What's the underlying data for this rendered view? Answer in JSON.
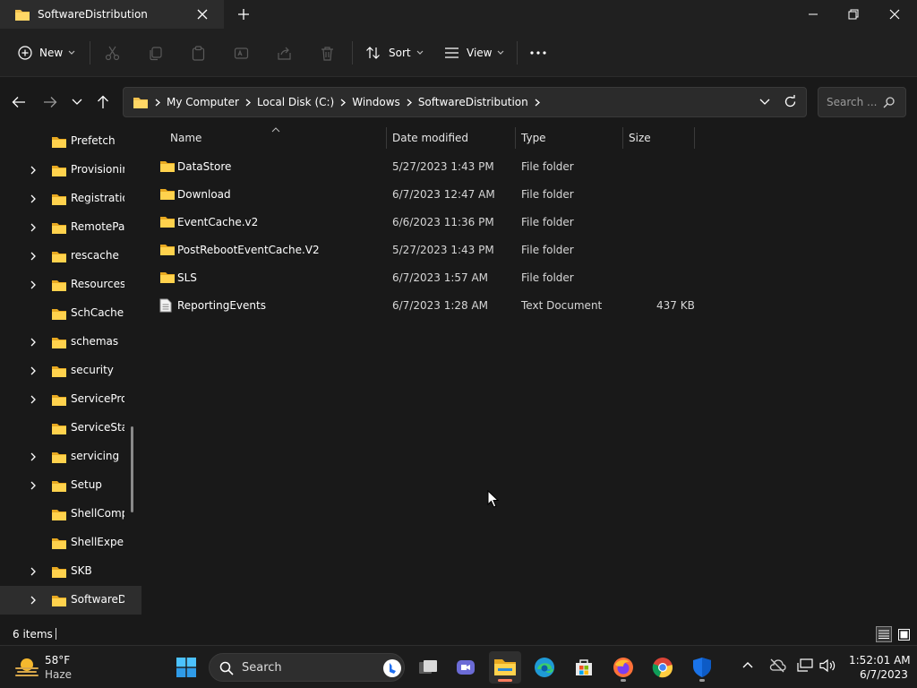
{
  "window": {
    "tab_title": "SoftwareDistribution",
    "buttons": [
      "minimize",
      "maximize",
      "close"
    ]
  },
  "toolbar": {
    "new_label": "New",
    "sort_label": "Sort",
    "view_label": "View",
    "icons": [
      "cut-icon",
      "copy-icon",
      "paste-icon",
      "rename-icon",
      "share-icon",
      "delete-icon",
      "more-icon"
    ]
  },
  "address": {
    "breadcrumbs": [
      "My Computer",
      "Local Disk (C:)",
      "Windows",
      "SoftwareDistribution"
    ],
    "search_placeholder": "Search ..."
  },
  "sidebar": {
    "items": [
      {
        "label": "Prefetch",
        "expandable": false,
        "selected": false
      },
      {
        "label": "Provisioning",
        "expandable": true,
        "selected": false
      },
      {
        "label": "Registration",
        "expandable": true,
        "selected": false
      },
      {
        "label": "RemotePackages",
        "expandable": true,
        "selected": false
      },
      {
        "label": "rescache",
        "expandable": true,
        "selected": false
      },
      {
        "label": "Resources",
        "expandable": true,
        "selected": false
      },
      {
        "label": "SchCache",
        "expandable": false,
        "selected": false
      },
      {
        "label": "schemas",
        "expandable": true,
        "selected": false
      },
      {
        "label": "security",
        "expandable": true,
        "selected": false
      },
      {
        "label": "ServiceProfiles",
        "expandable": true,
        "selected": false
      },
      {
        "label": "ServiceState",
        "expandable": false,
        "selected": false
      },
      {
        "label": "servicing",
        "expandable": true,
        "selected": false
      },
      {
        "label": "Setup",
        "expandable": true,
        "selected": false
      },
      {
        "label": "ShellComponents",
        "expandable": false,
        "selected": false
      },
      {
        "label": "ShellExperiences",
        "expandable": false,
        "selected": false
      },
      {
        "label": "SKB",
        "expandable": true,
        "selected": false
      },
      {
        "label": "SoftwareDistribution",
        "expandable": true,
        "selected": true
      }
    ]
  },
  "columns": {
    "name": "Name",
    "date": "Date modified",
    "type": "Type",
    "size": "Size"
  },
  "files": [
    {
      "name": "DataStore",
      "date": "5/27/2023 1:43 PM",
      "type": "File folder",
      "size": "",
      "kind": "folder"
    },
    {
      "name": "Download",
      "date": "6/7/2023 12:47 AM",
      "type": "File folder",
      "size": "",
      "kind": "folder"
    },
    {
      "name": "EventCache.v2",
      "date": "6/6/2023 11:36 PM",
      "type": "File folder",
      "size": "",
      "kind": "folder"
    },
    {
      "name": "PostRebootEventCache.V2",
      "date": "5/27/2023 1:43 PM",
      "type": "File folder",
      "size": "",
      "kind": "folder"
    },
    {
      "name": "SLS",
      "date": "6/7/2023 1:57 AM",
      "type": "File folder",
      "size": "",
      "kind": "folder"
    },
    {
      "name": "ReportingEvents",
      "date": "6/7/2023 1:28 AM",
      "type": "Text Document",
      "size": "437 KB",
      "kind": "text"
    }
  ],
  "status": {
    "item_count": "6 items"
  },
  "taskbar": {
    "weather_temp": "58°F",
    "weather_condition": "Haze",
    "search_label": "Search",
    "apps": [
      "start",
      "task-view",
      "teams-meet",
      "file-explorer",
      "edge",
      "microsoft-store",
      "firefox",
      "chrome",
      "defender"
    ],
    "clock_time": "1:52:01 AM",
    "clock_date": "6/7/2023"
  },
  "colors": {
    "folder": "#f2c14e",
    "accent": "#ff7d5e",
    "background": "#191919"
  }
}
